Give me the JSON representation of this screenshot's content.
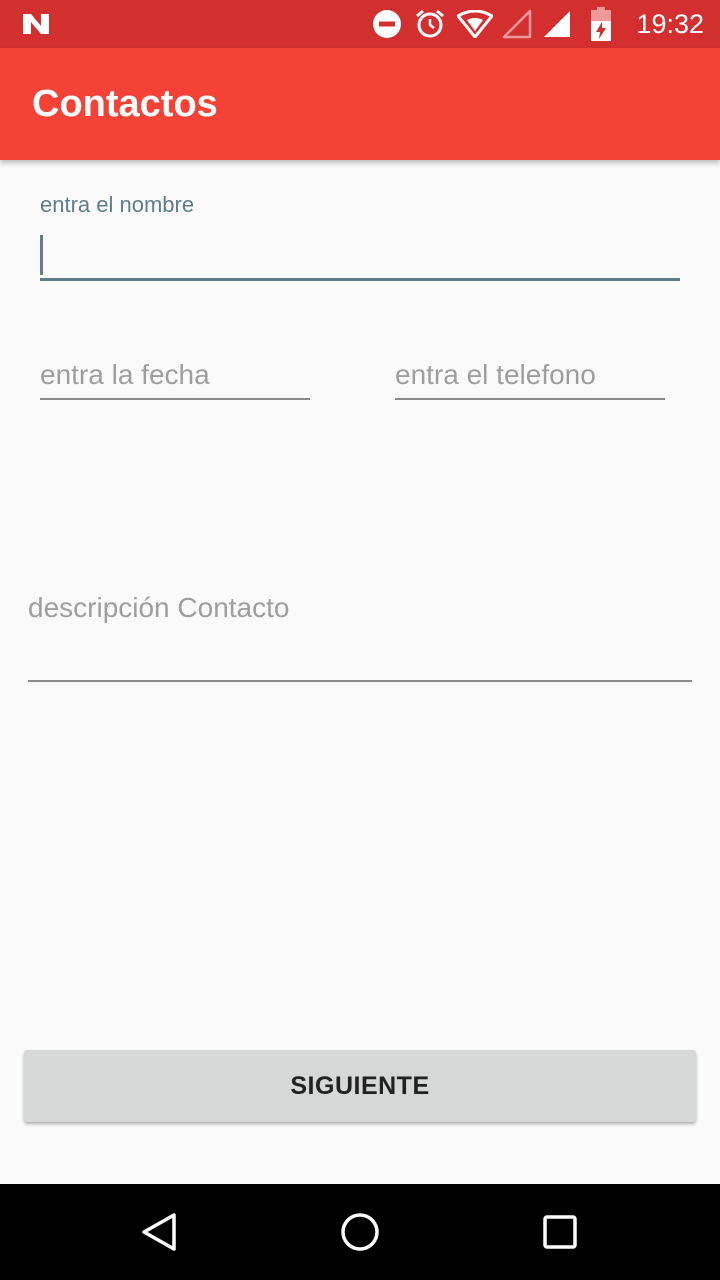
{
  "status_bar": {
    "time": "19:32",
    "icons": [
      "app-n-icon",
      "do-not-disturb-icon",
      "alarm-icon",
      "wifi-icon",
      "signal-empty-icon",
      "signal-icon",
      "battery-charging-icon"
    ],
    "background": "#d32f2f"
  },
  "app_bar": {
    "title": "Contactos",
    "background": "#f44336"
  },
  "form": {
    "nombre": {
      "label": "entra el nombre",
      "value": ""
    },
    "fecha": {
      "placeholder": "entra la fecha",
      "value": ""
    },
    "telefono": {
      "placeholder": "entra el telefono",
      "value": ""
    },
    "descripcion": {
      "placeholder": "descripción Contacto",
      "value": ""
    },
    "accent_color": "#607d8b"
  },
  "actions": {
    "next_label": "SIGUIENTE"
  },
  "nav_bar": {
    "icons": [
      "back-icon",
      "home-icon",
      "recents-icon"
    ]
  }
}
